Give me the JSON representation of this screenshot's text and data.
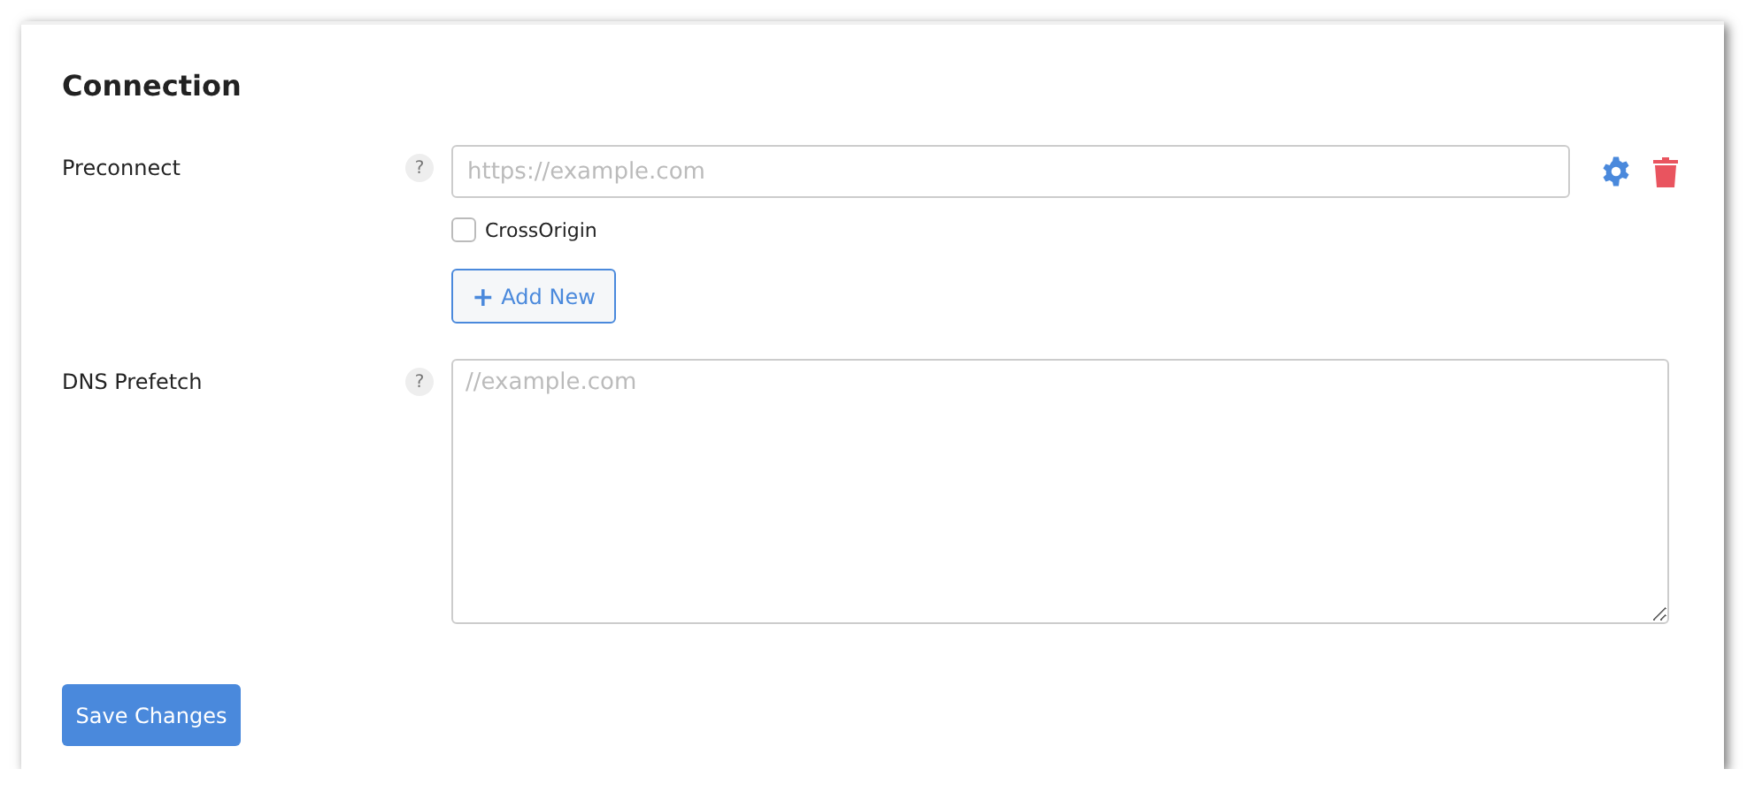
{
  "section": {
    "title": "Connection"
  },
  "preconnect": {
    "label": "Preconnect",
    "help": "?",
    "placeholder": "https://example.com",
    "crossorigin": {
      "label": "CrossOrigin",
      "checked": false
    },
    "add_button": {
      "icon": "+",
      "label": "Add New"
    }
  },
  "dns_prefetch": {
    "label": "DNS Prefetch",
    "help": "?",
    "placeholder": "//example.com"
  },
  "save_button": "Save Changes"
}
